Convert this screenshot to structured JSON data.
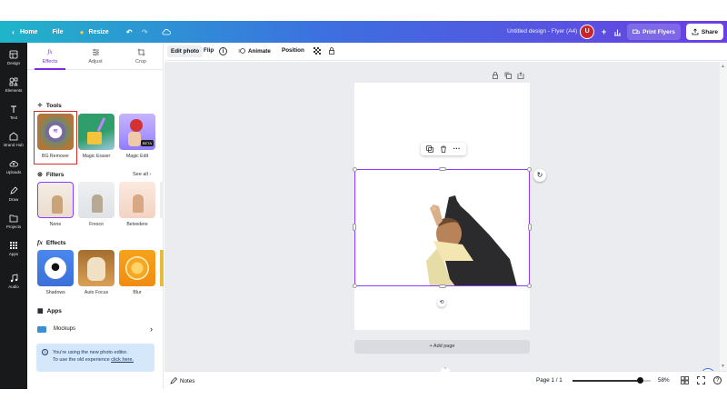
{
  "topbar": {
    "home_label": "Home",
    "file_label": "File",
    "resize_label": "Resize",
    "doc_title": "Untitled design - Flyer (A4)",
    "avatar_letter": "U",
    "print_label": "Print Flyers",
    "share_label": "Share"
  },
  "rail": {
    "items": [
      {
        "label": "Design"
      },
      {
        "label": "Elements"
      },
      {
        "label": "Text"
      },
      {
        "label": "Brand Hub"
      },
      {
        "label": "Uploads"
      },
      {
        "label": "Draw"
      },
      {
        "label": "Projects"
      },
      {
        "label": "Apps"
      },
      {
        "label": "Audio"
      }
    ]
  },
  "panel": {
    "tabs": [
      {
        "label": "Effects"
      },
      {
        "label": "Adjust"
      },
      {
        "label": "Crop"
      }
    ],
    "tools_heading": "Tools",
    "tools": [
      {
        "label": "BG Remover"
      },
      {
        "label": "Magic Eraser"
      },
      {
        "label": "Magic Edit",
        "badge": "BETA"
      }
    ],
    "filters_heading": "Filters",
    "see_all": "See all",
    "filters": [
      {
        "label": "None"
      },
      {
        "label": "Fresco"
      },
      {
        "label": "Belvedere"
      }
    ],
    "effects_heading": "Effects",
    "effects": [
      {
        "label": "Shadows"
      },
      {
        "label": "Auto Focus"
      },
      {
        "label": "Blur"
      }
    ],
    "apps_heading": "Apps",
    "mockups_label": "Mockups",
    "notice_line1": "You're using the new photo editor.",
    "notice_line2": "To use the old experience",
    "notice_link": "click here."
  },
  "toolbar": {
    "edit_photo": "Edit photo",
    "flip": "Flip",
    "animate": "Animate",
    "position": "Position"
  },
  "canvas": {
    "add_page": "+ Add page"
  },
  "bottombar": {
    "notes": "Notes",
    "page_indicator": "Page 1 / 1",
    "zoom": "58%",
    "zoom_level": 0.58
  },
  "colors": {
    "accent": "#7d2ae8",
    "selection": "#8b3dff",
    "highlight_box": "#d42a2a",
    "rail_bg": "#18191b"
  }
}
